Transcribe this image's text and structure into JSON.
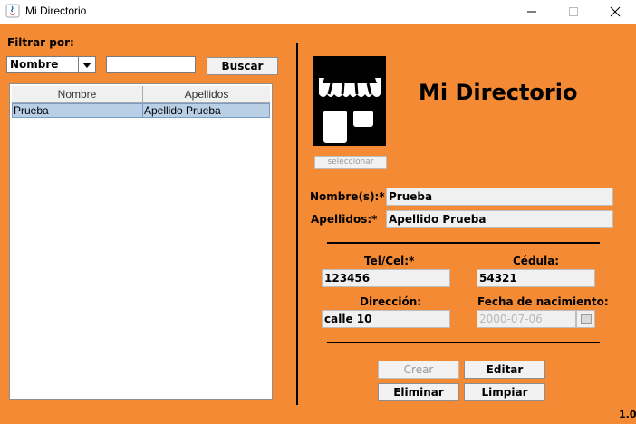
{
  "window": {
    "title": "Mi Directorio"
  },
  "filter": {
    "label": "Filtrar por:",
    "selected_option": "Nombre",
    "query": "",
    "search_label": "Buscar"
  },
  "table": {
    "columns": [
      "Nombre",
      "Apellidos"
    ],
    "rows": [
      {
        "nombre": "Prueba",
        "apellidos": "Apellido Prueba"
      }
    ]
  },
  "header": {
    "title": "Mi Directorio",
    "select_image_label": "seleccionar"
  },
  "form": {
    "nombre_label": "Nombre(s):*",
    "nombre_value": "Prueba",
    "apellidos_label": "Apellidos:*",
    "apellidos_value": "Apellido Prueba",
    "tel_label": "Tel/Cel:*",
    "tel_value": "123456",
    "cedula_label": "Cédula:",
    "cedula_value": "54321",
    "direccion_label": "Dirección:",
    "direccion_value": "calle 10",
    "fecha_label": "Fecha de nacimiento:",
    "fecha_value": "2000-07-06"
  },
  "actions": {
    "crear": "Crear",
    "editar": "Editar",
    "eliminar": "Eliminar",
    "limpiar": "Limpiar"
  },
  "version": "1.0",
  "colors": {
    "background": "#F58A35",
    "row_selected": "#B8CFE5"
  },
  "icons": [
    "java-app-icon",
    "store-icon",
    "calendar-icon",
    "minimize-icon",
    "maximize-icon",
    "close-icon",
    "chevron-down-icon"
  ]
}
